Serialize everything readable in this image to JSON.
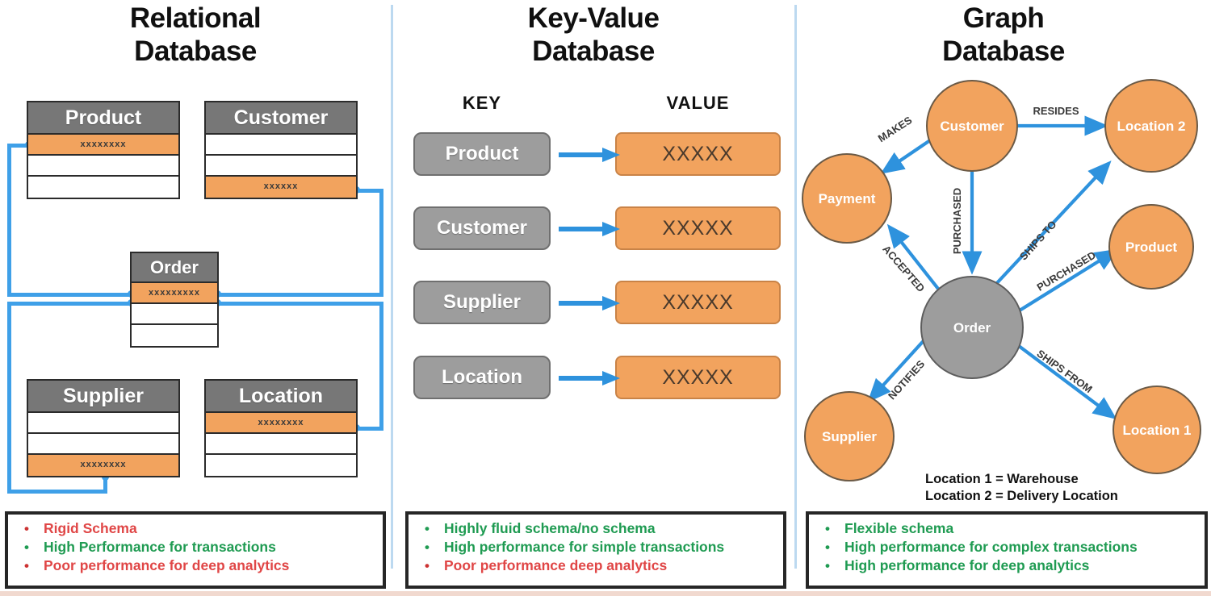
{
  "columns": {
    "relational": {
      "title_line1": "Relational",
      "title_line2": "Database"
    },
    "keyvalue": {
      "title_line1": "Key-Value",
      "title_line2": "Database"
    },
    "graph": {
      "title_line1": "Graph",
      "title_line2": "Database"
    }
  },
  "relational": {
    "tables": [
      {
        "name": "Product",
        "rows": [
          "xxxxxxxx",
          "",
          ""
        ],
        "orange_row_index": 0
      },
      {
        "name": "Customer",
        "rows": [
          "",
          "",
          "xxxxxx"
        ],
        "orange_row_index": 2
      },
      {
        "name": "Order",
        "rows": [
          "xxxxxxxxx",
          "",
          ""
        ],
        "orange_row_index": 0
      },
      {
        "name": "Supplier",
        "rows": [
          "",
          "",
          "xxxxxxxx"
        ],
        "orange_row_index": 2
      },
      {
        "name": "Location",
        "rows": [
          "xxxxxxxx",
          "",
          ""
        ],
        "orange_row_index": 0
      }
    ],
    "notes": [
      {
        "text": "Rigid Schema",
        "tone": "bad"
      },
      {
        "text": "High Performance for transactions",
        "tone": "good"
      },
      {
        "text": "Poor performance for deep analytics",
        "tone": "bad"
      }
    ]
  },
  "keyvalue": {
    "key_header": "KEY",
    "value_header": "VALUE",
    "pairs": [
      {
        "key": "Product",
        "value": "XXXXX"
      },
      {
        "key": "Customer",
        "value": "XXXXX"
      },
      {
        "key": "Supplier",
        "value": "XXXXX"
      },
      {
        "key": "Location",
        "value": "XXXXX"
      }
    ],
    "notes": [
      {
        "text": "Highly fluid schema/no schema",
        "tone": "good"
      },
      {
        "text": "High performance for simple transactions",
        "tone": "good"
      },
      {
        "text": "Poor performance deep analytics",
        "tone": "bad"
      }
    ]
  },
  "graph": {
    "nodes": [
      {
        "id": "customer",
        "label": "Customer",
        "color": "orange"
      },
      {
        "id": "payment",
        "label": "Payment",
        "color": "orange"
      },
      {
        "id": "location2",
        "label": "Location 2",
        "color": "orange"
      },
      {
        "id": "product",
        "label": "Product",
        "color": "orange"
      },
      {
        "id": "order",
        "label": "Order",
        "color": "grey"
      },
      {
        "id": "supplier",
        "label": "Supplier",
        "color": "orange"
      },
      {
        "id": "location1",
        "label": "Location 1",
        "color": "orange"
      }
    ],
    "edges": [
      {
        "from": "customer",
        "to": "payment",
        "label": "MAKES"
      },
      {
        "from": "customer",
        "to": "location2",
        "label": "RESIDES"
      },
      {
        "from": "customer",
        "to": "order",
        "label": "PURCHASED"
      },
      {
        "from": "order",
        "to": "payment",
        "label": "ACCEPTED"
      },
      {
        "from": "order",
        "to": "location2",
        "label": "SHIPS TO"
      },
      {
        "from": "order",
        "to": "product",
        "label": "PURCHASED"
      },
      {
        "from": "order",
        "to": "supplier",
        "label": "NOTIFIES"
      },
      {
        "from": "order",
        "to": "location1",
        "label": "SHIPS FROM"
      }
    ],
    "legend": [
      "Location 1 = Warehouse",
      "Location 2 = Delivery Location"
    ],
    "notes": [
      {
        "text": "Flexible schema",
        "tone": "good"
      },
      {
        "text": "High performance for complex transactions",
        "tone": "good"
      },
      {
        "text": "High performance for deep analytics",
        "tone": "good"
      }
    ]
  },
  "colors": {
    "orange": "#F2A35E",
    "grey": "#9D9D9D",
    "header_grey": "#777777",
    "connector_blue": "#3FA0E8",
    "divider_blue": "#BCD9F0",
    "good_green": "#1F9B52",
    "bad_red": "#E04646"
  }
}
